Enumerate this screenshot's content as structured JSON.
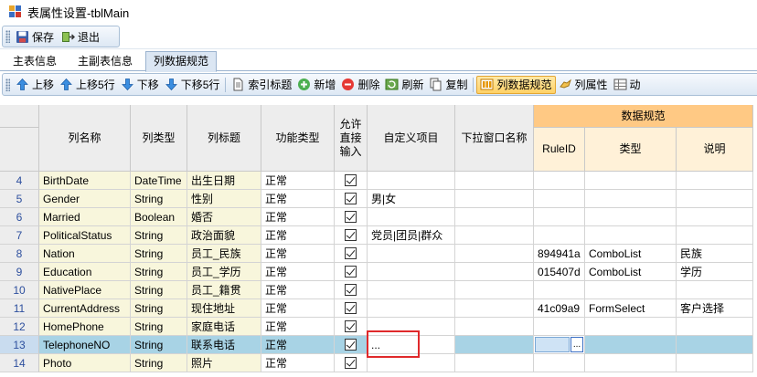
{
  "window": {
    "title": "表属性设置-tblMain"
  },
  "toolbar_top": {
    "save_label": "保存",
    "exit_label": "退出"
  },
  "tabs": [
    {
      "label": "主表信息"
    },
    {
      "label": "主副表信息"
    },
    {
      "label": "列数据规范"
    }
  ],
  "toolbar_grid": {
    "move_up": "上移",
    "move_up5": "上移5行",
    "move_down": "下移",
    "move_down5": "下移5行",
    "index_title": "索引标题",
    "add": "新增",
    "delete": "删除",
    "refresh": "刷新",
    "copy": "复制",
    "col_spec": "列数据规范",
    "col_attr": "列属性",
    "more": "动"
  },
  "grid": {
    "headers": {
      "col_name": "列名称",
      "col_type": "列类型",
      "col_title": "列标题",
      "func_type": "功能类型",
      "allow_input": "允许直接输入",
      "custom_items": "自定义项目",
      "dropdown_name": "下拉窗口名称",
      "data_spec": "数据规范",
      "rule_id": "RuleID",
      "type": "类型",
      "desc": "说明"
    },
    "rows": [
      {
        "num": "4",
        "name": "BirthDate",
        "type": "DateTime",
        "title": "出生日期",
        "func": "正常",
        "custom": "",
        "rule": "",
        "rtype": "",
        "desc": ""
      },
      {
        "num": "5",
        "name": "Gender",
        "type": "String",
        "title": "性别",
        "func": "正常",
        "custom": "男|女",
        "rule": "",
        "rtype": "",
        "desc": ""
      },
      {
        "num": "6",
        "name": "Married",
        "type": "Boolean",
        "title": "婚否",
        "func": "正常",
        "custom": "",
        "rule": "",
        "rtype": "",
        "desc": ""
      },
      {
        "num": "7",
        "name": "PoliticalStatus",
        "type": "String",
        "title": "政治面貌",
        "func": "正常",
        "custom": "党员|团员|群众",
        "rule": "",
        "rtype": "",
        "desc": ""
      },
      {
        "num": "8",
        "name": "Nation",
        "type": "String",
        "title": "员工_民族",
        "func": "正常",
        "custom": "",
        "rule": "894941a",
        "rtype": "ComboList",
        "desc": "民族"
      },
      {
        "num": "9",
        "name": "Education",
        "type": "String",
        "title": "员工_学历",
        "func": "正常",
        "custom": "",
        "rule": "015407d",
        "rtype": "ComboList",
        "desc": "学历"
      },
      {
        "num": "10",
        "name": "NativePlace",
        "type": "String",
        "title": "员工_籍贯",
        "func": "正常",
        "custom": "",
        "rule": "",
        "rtype": "",
        "desc": ""
      },
      {
        "num": "11",
        "name": "CurrentAddress",
        "type": "String",
        "title": "现住地址",
        "func": "正常",
        "custom": "",
        "rule": "41c09a9",
        "rtype": "FormSelect",
        "desc": "客户选择"
      },
      {
        "num": "12",
        "name": "HomePhone",
        "type": "String",
        "title": "家庭电话",
        "func": "正常",
        "custom": "",
        "rule": "",
        "rtype": "",
        "desc": ""
      },
      {
        "num": "13",
        "name": "TelephoneNO",
        "type": "String",
        "title": "联系电话",
        "func": "正常",
        "custom": "...",
        "rule": "",
        "rtype": "",
        "desc": ""
      },
      {
        "num": "14",
        "name": "Photo",
        "type": "String",
        "title": "照片",
        "func": "正常",
        "custom": "",
        "rule": "",
        "rtype": "",
        "desc": ""
      }
    ],
    "editing_cell_button": "..."
  }
}
